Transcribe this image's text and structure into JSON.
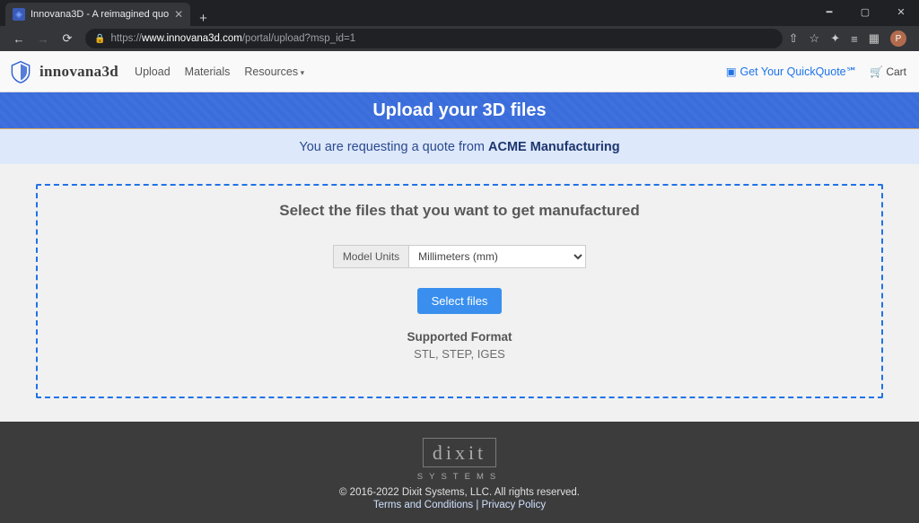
{
  "browser": {
    "tab_title": "Innovana3D - A reimagined quo",
    "url_prefix": "https://",
    "url_host": "www.innovana3d.com",
    "url_path": "/portal/upload?msp_id=1",
    "avatar_letter": "P"
  },
  "header": {
    "brand": "innovana3d",
    "nav": {
      "upload": "Upload",
      "materials": "Materials",
      "resources": "Resources"
    },
    "quickquote": "Get Your QuickQuote℠",
    "cart": "Cart"
  },
  "hero": {
    "title": "Upload your 3D files"
  },
  "banner": {
    "prefix": "You are requesting a quote from ",
    "company": "ACME Manufacturing"
  },
  "upload": {
    "heading": "Select the files that you want to get manufactured",
    "units_label": "Model Units",
    "units_value": "Millimeters (mm)",
    "select_btn": "Select files",
    "supported_heading": "Supported Format",
    "supported_list": "STL, STEP, IGES"
  },
  "footer": {
    "logo_main": "dixit",
    "logo_sub": "SYSTEMS",
    "copyright": "© 2016-2022 Dixit Systems, LLC. All rights reserved.",
    "terms": "Terms and Conditions",
    "sep": " | ",
    "privacy": "Privacy Policy"
  }
}
